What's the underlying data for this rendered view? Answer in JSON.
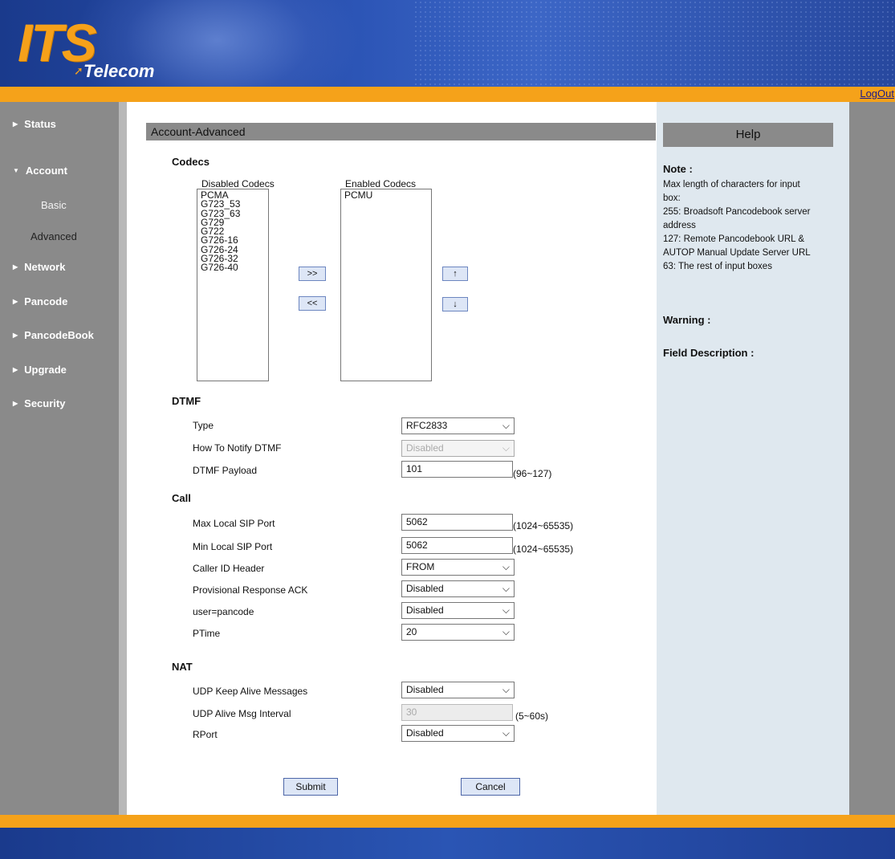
{
  "brand": {
    "logo_main": "ITS",
    "logo_sub": "Telecom"
  },
  "logout_label": "LogOut",
  "sidebar": {
    "items": [
      {
        "label": "Status"
      },
      {
        "label": "Account"
      },
      {
        "label": "Network"
      },
      {
        "label": "Pancode"
      },
      {
        "label": "PancodeBook"
      },
      {
        "label": "Upgrade"
      },
      {
        "label": "Security"
      }
    ],
    "account_sub": [
      {
        "label": "Basic"
      },
      {
        "label": "Advanced"
      }
    ]
  },
  "page_title": "Account-Advanced",
  "codecs": {
    "section": "Codecs",
    "disabled_label": "Disabled Codecs",
    "enabled_label": "Enabled Codecs",
    "disabled": [
      "PCMA",
      "G723_53",
      "G723_63",
      "G729",
      "G722",
      "G726-16",
      "G726-24",
      "G726-32",
      "G726-40"
    ],
    "enabled": [
      "PCMU"
    ],
    "add_btn": ">>",
    "remove_btn": "<<",
    "up_btn": "↑",
    "down_btn": "↓"
  },
  "dtmf": {
    "section": "DTMF",
    "type_label": "Type",
    "type_value": "RFC2833",
    "notify_label": "How To Notify DTMF",
    "notify_value": "Disabled",
    "payload_label": "DTMF Payload",
    "payload_value": "101",
    "payload_range": "(96~127)"
  },
  "call": {
    "section": "Call",
    "max_port_label": "Max Local SIP Port",
    "max_port_value": "5062",
    "max_port_range": "(1024~65535)",
    "min_port_label": "Min Local SIP Port",
    "min_port_value": "5062",
    "min_port_range": "(1024~65535)",
    "caller_id_label": "Caller ID Header",
    "caller_id_value": "FROM",
    "prov_ack_label": "Provisional Response ACK",
    "prov_ack_value": "Disabled",
    "user_pancode_label": "user=pancode",
    "user_pancode_value": "Disabled",
    "ptime_label": "PTime",
    "ptime_value": "20"
  },
  "nat": {
    "section": "NAT",
    "keepalive_label": "UDP Keep Alive Messages",
    "keepalive_value": "Disabled",
    "interval_label": "UDP Alive Msg Interval",
    "interval_value": "30",
    "interval_range": "(5~60s)",
    "rport_label": "RPort",
    "rport_value": "Disabled"
  },
  "buttons": {
    "submit": "Submit",
    "cancel": "Cancel"
  },
  "help": {
    "title": "Help",
    "note_label": "Note :",
    "note_lines": [
      "Max length of characters for input",
      "box:",
      "255: Broadsoft Pancodebook server",
      "address",
      "127: Remote Pancodebook URL &",
      "AUTOP Manual Update Server URL",
      "63: The rest of input boxes"
    ],
    "warning_label": "Warning :",
    "field_desc_label": "Field Description :"
  },
  "colors": {
    "orange": "#f5a21a",
    "header_blue": "#2c55b6",
    "sidebar_gray": "#8a8a8a",
    "help_bg": "#dfe8ef"
  }
}
